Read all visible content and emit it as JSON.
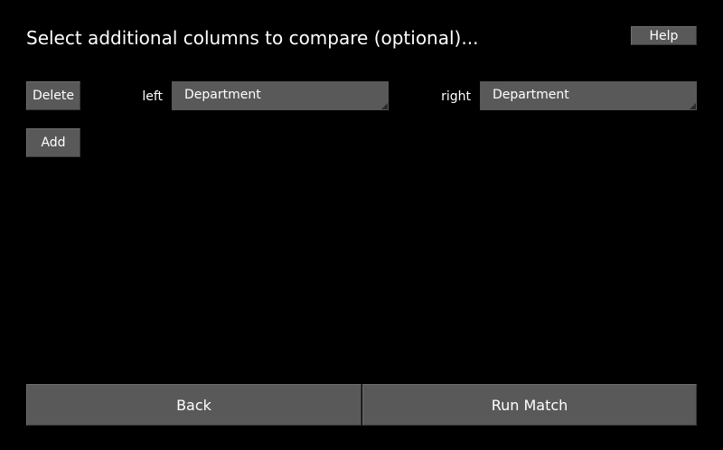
{
  "header": {
    "title": "Select additional columns to compare (optional)...",
    "help_label": "Help"
  },
  "rows": [
    {
      "delete_label": "Delete",
      "left_label": "left",
      "left_value": "Department",
      "right_label": "right",
      "right_value": "Department"
    }
  ],
  "add_label": "Add",
  "footer": {
    "back_label": "Back",
    "run_label": "Run Match"
  },
  "colors": {
    "background": "#000000",
    "control": "#595959",
    "text": "#ffffff"
  },
  "icons": {
    "dropdown_indicator": "corner-triangle-icon"
  }
}
